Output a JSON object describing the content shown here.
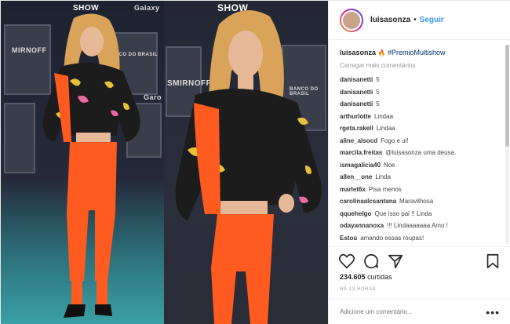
{
  "header": {
    "username": "luisasonza",
    "separator": "•",
    "follow_label": "Seguir"
  },
  "caption": {
    "username": "luisasonza",
    "hashtag": "#PremioMultishow"
  },
  "load_more": "Carregar mais comentários",
  "comments": [
    {
      "user": "danisanetti",
      "text": "5"
    },
    {
      "user": "danisanetti",
      "text": "5"
    },
    {
      "user": "danisanetti",
      "text": "5"
    },
    {
      "user": "arthurlotte",
      "text": "Lindaa"
    },
    {
      "user": "rgeta.rakell",
      "text": "Lindaa"
    },
    {
      "user": "aline_alsocd",
      "text": "Fogo e ui!"
    },
    {
      "user": "marcila.freitas",
      "text": "@luisasonza uma deusa."
    },
    {
      "user": "ismagalicia40",
      "text": "Noe"
    },
    {
      "user": "allen__one",
      "text": "Linda"
    },
    {
      "user": "marlet6x",
      "text": "Pisa menos"
    },
    {
      "user": "carolinaalcsantana",
      "text": "Maravilhosa"
    },
    {
      "user": "qquehelgo",
      "text": "Que isso pai !! Linda"
    },
    {
      "user": "odayannanoxa",
      "text": "!!! Lindaaaaaaa Amo !"
    },
    {
      "user": "Estou",
      "text": "amando essas roupas!"
    }
  ],
  "likes": {
    "count": "234.605",
    "label": "curtidas"
  },
  "timestamp": "HÁ 13 HORAS",
  "add_comment_placeholder": "Adicione um comentário...",
  "more_label": "•••",
  "photo": {
    "backdrop_texts": [
      "SHOW",
      "Galaxy",
      "MIRNOFF",
      "BANCO DO BRASIL",
      "Garo",
      "SMIRNOFF",
      "BANCO DO BRASIL",
      "SHOW"
    ]
  },
  "colors": {
    "accent": "#3897f0",
    "text": "#262626",
    "muted": "#999999",
    "orange": "#ff5a1f",
    "teal_carpet": "#3aa0a5"
  }
}
